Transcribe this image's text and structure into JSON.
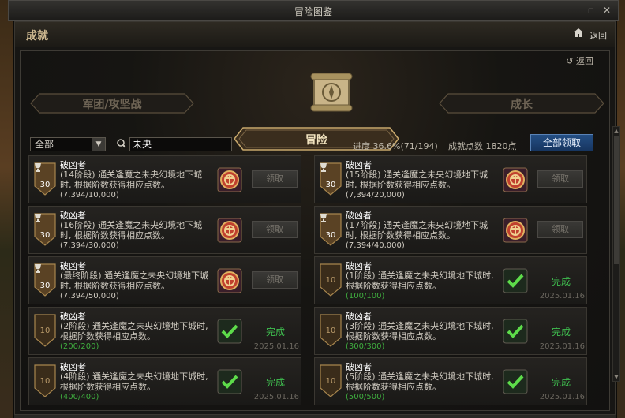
{
  "window": {
    "title": "冒险图鉴"
  },
  "header": {
    "title": "成就",
    "back_label": "返回"
  },
  "panel": {
    "back_label": "返回"
  },
  "tabs": {
    "left": "军团/攻坚战",
    "center": "冒险",
    "right": "成长"
  },
  "filter": {
    "selected": "全部"
  },
  "search": {
    "value": "未央"
  },
  "progress": {
    "label": "进度",
    "percent": "36.6%",
    "count": "(71/194)"
  },
  "points": {
    "label": "成就点数",
    "value": "1820点"
  },
  "claim_all_label": "全部领取",
  "colors": {
    "complete_green": "#3fbf4f",
    "progress_green": "#3fae3f",
    "claim_all_blue": "#244f84"
  },
  "cards": [
    {
      "title": "破凶者",
      "desc": "(14阶段) 通关逢魔之未央幻境地下城时, 根据阶数获得相应点数。",
      "progress": "(7,394/10,000)",
      "points": "30",
      "status": "pending",
      "button": "领取"
    },
    {
      "title": "破凶者",
      "desc": "(15阶段) 通关逢魔之未央幻境地下城时, 根据阶数获得相应点数。",
      "progress": "(7,394/20,000)",
      "points": "30",
      "status": "pending",
      "button": "领取"
    },
    {
      "title": "破凶者",
      "desc": "(16阶段) 通关逢魔之未央幻境地下城时, 根据阶数获得相应点数。",
      "progress": "(7,394/30,000)",
      "points": "30",
      "status": "pending",
      "button": "领取"
    },
    {
      "title": "破凶者",
      "desc": "(17阶段) 通关逢魔之未央幻境地下城时, 根据阶数获得相应点数。",
      "progress": "(7,394/40,000)",
      "points": "30",
      "status": "pending",
      "button": "领取"
    },
    {
      "title": "破凶者",
      "desc": "(最终阶段) 通关逢魔之未央幻境地下城时, 根据阶数获得相应点数。",
      "progress": "(7,394/50,000)",
      "points": "30",
      "status": "pending",
      "button": "领取"
    },
    {
      "title": "破凶者",
      "desc": "(1阶段) 通关逢魔之未央幻境地下城时, 根据阶数获得相应点数。",
      "progress": "(100/100)",
      "points": "10",
      "status": "done",
      "status_text": "完成",
      "date": "2025.01.16"
    },
    {
      "title": "破凶者",
      "desc": "(2阶段) 通关逢魔之未央幻境地下城时, 根据阶数获得相应点数。",
      "progress": "(200/200)",
      "points": "10",
      "status": "done",
      "status_text": "完成",
      "date": "2025.01.16"
    },
    {
      "title": "破凶者",
      "desc": "(3阶段) 通关逢魔之未央幻境地下城时, 根据阶数获得相应点数。",
      "progress": "(300/300)",
      "points": "10",
      "status": "done",
      "status_text": "完成",
      "date": "2025.01.16"
    },
    {
      "title": "破凶者",
      "desc": "(4阶段) 通关逢魔之未央幻境地下城时, 根据阶数获得相应点数。",
      "progress": "(400/400)",
      "points": "10",
      "status": "done",
      "status_text": "完成",
      "date": "2025.01.16"
    },
    {
      "title": "破凶者",
      "desc": "(5阶段) 通关逢魔之未央幻境地下城时, 根据阶数获得相应点数。",
      "progress": "(500/500)",
      "points": "10",
      "status": "done",
      "status_text": "完成",
      "date": "2025.01.16"
    }
  ]
}
